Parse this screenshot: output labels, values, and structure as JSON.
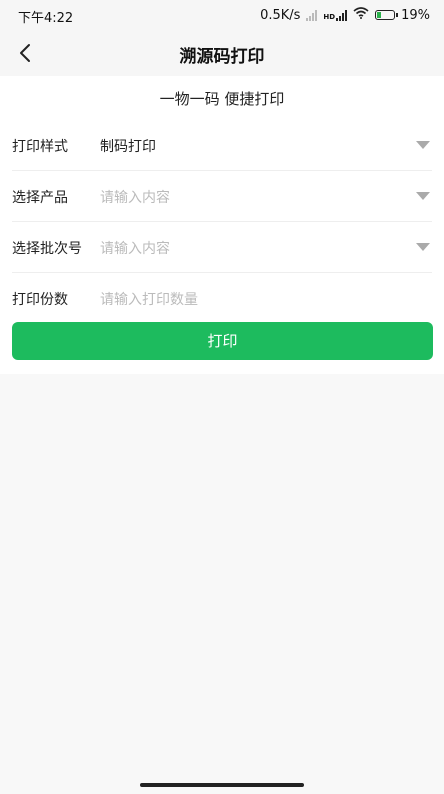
{
  "status_bar": {
    "time": "下午4:22",
    "network_speed": "0.5K/s",
    "hd_badge": "HD",
    "battery": "19%"
  },
  "navbar": {
    "title": "溯源码打印",
    "back_icon": "chevron-left-icon"
  },
  "form": {
    "subtitle": "一物一码 便捷打印",
    "rows": [
      {
        "label": "打印样式",
        "value": "制码打印",
        "placeholder": "",
        "has_dropdown": true
      },
      {
        "label": "选择产品",
        "value": "",
        "placeholder": "请输入内容",
        "has_dropdown": true
      },
      {
        "label": "选择批次号",
        "value": "",
        "placeholder": "请输入内容",
        "has_dropdown": true
      },
      {
        "label": "打印份数",
        "value": "",
        "placeholder": "请输入打印数量",
        "has_dropdown": false
      }
    ],
    "print_button": "打印"
  },
  "colors": {
    "accent": "#1dbb5e"
  }
}
